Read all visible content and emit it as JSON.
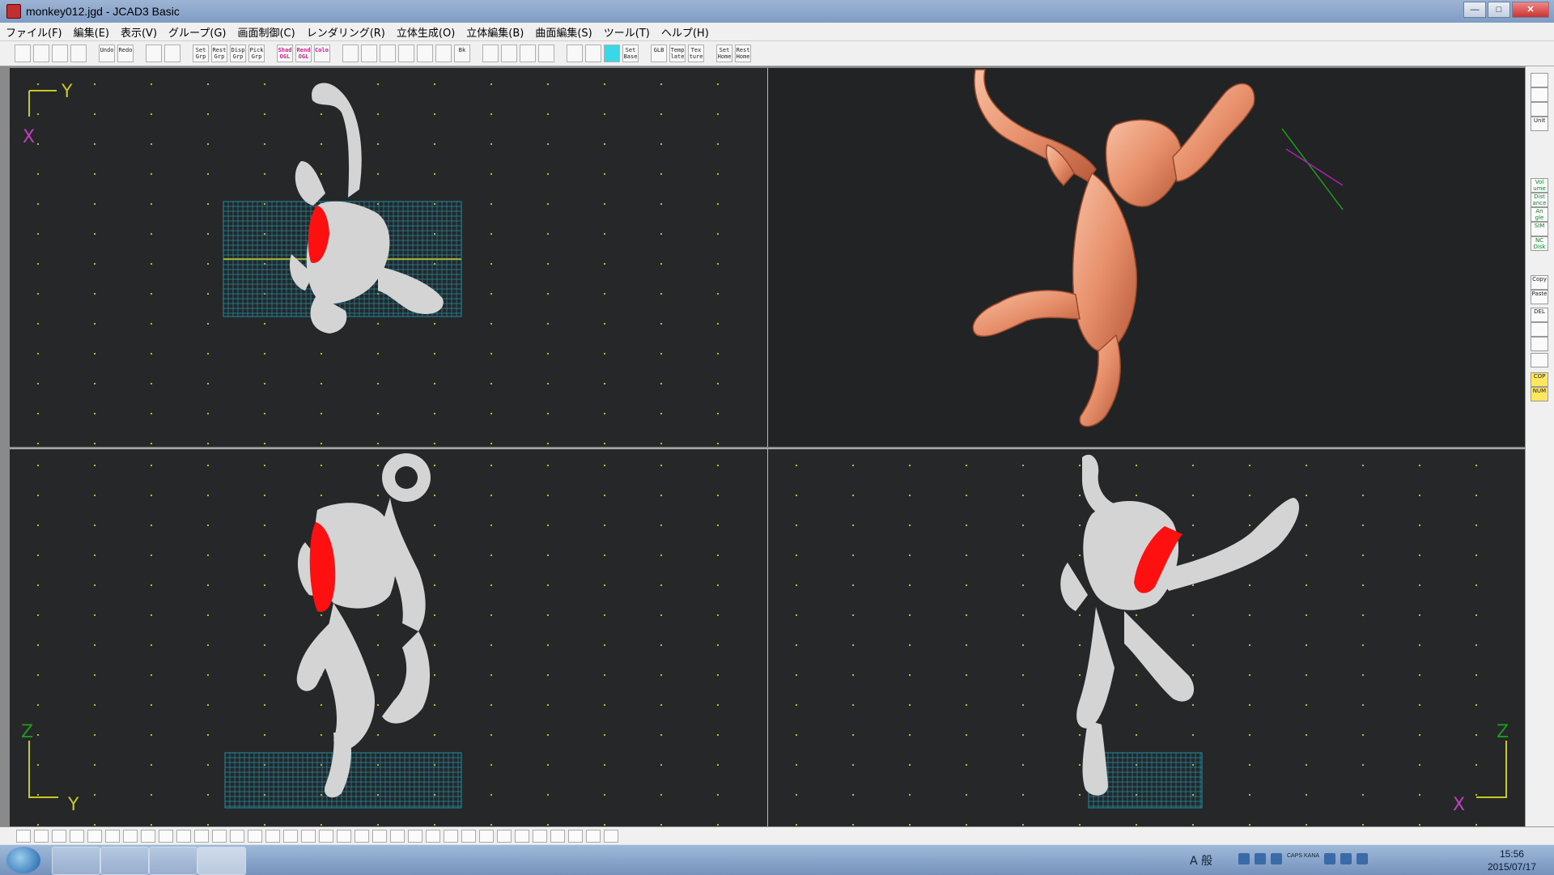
{
  "window": {
    "title": "monkey012.jgd - JCAD3 Basic",
    "controls": [
      "—",
      "□",
      "✕"
    ]
  },
  "menu": [
    "ファイル(F)",
    "編集(E)",
    "表示(V)",
    "グループ(G)",
    "画面制御(C)",
    "レンダリング(R)",
    "立体生成(O)",
    "立体編集(B)",
    "曲面編集(S)",
    "ツール(T)",
    "ヘルプ(H)"
  ],
  "toolbar": [
    {
      "icon": "new-file-icon",
      "label": ""
    },
    {
      "icon": "open-folder-icon",
      "label": ""
    },
    {
      "icon": "save-icon",
      "label": ""
    },
    {
      "icon": "print-icon",
      "label": ""
    },
    {
      "gap": true
    },
    {
      "icon": "undo-icon",
      "label": "Undo"
    },
    {
      "icon": "redo-icon",
      "label": "Redo"
    },
    {
      "gap": true
    },
    {
      "icon": "group-select-icon",
      "label": ""
    },
    {
      "icon": "group-grid-icon",
      "label": ""
    },
    {
      "gap": true
    },
    {
      "icon": "set-group-icon",
      "label": "Set Grp"
    },
    {
      "icon": "reset-group-icon",
      "label": "Rest Grp"
    },
    {
      "icon": "display-group-icon",
      "label": "Disp Grp"
    },
    {
      "icon": "pick-group-icon",
      "label": "Pick Grp"
    },
    {
      "gap": true
    },
    {
      "icon": "shade-ogl-icon",
      "label": "Shad OGL",
      "style": "pink"
    },
    {
      "icon": "rend-ogl-icon",
      "label": "Rend OGL",
      "style": "pink"
    },
    {
      "icon": "color-icon",
      "label": "Color",
      "style": "pink"
    },
    {
      "gap": true
    },
    {
      "icon": "zoom-in-icon",
      "label": ""
    },
    {
      "icon": "zoom-out-icon",
      "label": ""
    },
    {
      "icon": "zoom-window-icon",
      "label": ""
    },
    {
      "icon": "zoom-fit-icon",
      "label": ""
    },
    {
      "icon": "zoom-all-icon",
      "label": ""
    },
    {
      "icon": "pan-icon",
      "label": ""
    },
    {
      "icon": "back-icon",
      "label": "Bk"
    },
    {
      "gap": true
    },
    {
      "icon": "zoom-tool-1-icon",
      "label": ""
    },
    {
      "icon": "zoom-tool-2-icon",
      "label": ""
    },
    {
      "icon": "zoom-tool-3-icon",
      "label": ""
    },
    {
      "icon": "zoom-tool-4-icon",
      "label": ""
    },
    {
      "gap": true
    },
    {
      "icon": "grid-dots-icon",
      "label": ""
    },
    {
      "icon": "grid-snap-icon",
      "label": ""
    },
    {
      "icon": "grid-active-icon",
      "label": "",
      "style": "cyan"
    },
    {
      "icon": "set-base-icon",
      "label": "Set Base"
    },
    {
      "gap": true
    },
    {
      "icon": "glb-icon",
      "label": "GLB"
    },
    {
      "icon": "template-icon",
      "label": "Temp late"
    },
    {
      "icon": "texture-icon",
      "label": "Tex ture"
    },
    {
      "gap": true
    },
    {
      "icon": "set-home-icon",
      "label": "Set Home"
    },
    {
      "icon": "rest-home-icon",
      "label": "Rest Home"
    }
  ],
  "viewports": {
    "top": {
      "axis_v": "Y",
      "axis_h": "X"
    },
    "front": {
      "axis_v": "Z",
      "axis_h": "Y"
    },
    "side": {
      "axis_v": "Z",
      "axis_h": "X"
    }
  },
  "right_palette": [
    {
      "icon": "view-1-icon",
      "label": ""
    },
    {
      "icon": "view-2-icon",
      "label": ""
    },
    {
      "icon": "view-3-icon",
      "label": ""
    },
    {
      "icon": "unit-icon",
      "label": "Unit"
    },
    {
      "icon": "volume-icon",
      "label": "Vol ume",
      "style": "green"
    },
    {
      "icon": "distance-icon",
      "label": "Dist ance",
      "style": "green"
    },
    {
      "icon": "angle-icon",
      "label": "An gle",
      "style": "green"
    },
    {
      "icon": "sim-icon",
      "label": "SIM",
      "style": "green"
    },
    {
      "icon": "nc-disk-icon",
      "label": "NC Disk",
      "style": "green"
    },
    {
      "icon": "copy-icon",
      "label": "Copy"
    },
    {
      "icon": "paste-icon",
      "label": "Paste"
    },
    {
      "icon": "delete-icon",
      "label": "DEL"
    },
    {
      "icon": "tool-a-icon",
      "label": ""
    },
    {
      "icon": "tool-b-icon",
      "label": ""
    },
    {
      "icon": "tool-c-icon",
      "label": ""
    },
    {
      "icon": "cop-icon",
      "label": "COP",
      "style": "yellow"
    },
    {
      "icon": "num-icon",
      "label": "NUM",
      "style": "yellow"
    }
  ],
  "taskbar": {
    "ime": "A 般",
    "caps": "CAPS KANA",
    "time": "15:56",
    "date": "2015/07/17",
    "apps": [
      "internet-explorer-icon",
      "file-explorer-icon",
      "chrome-icon",
      "jcad3-icon"
    ]
  },
  "colors": {
    "viewport_bg": "#262728",
    "mesh": "#d4d4d4",
    "selection": "#ff1010",
    "grid": "#1f8fa8",
    "render": "#e8906c"
  }
}
